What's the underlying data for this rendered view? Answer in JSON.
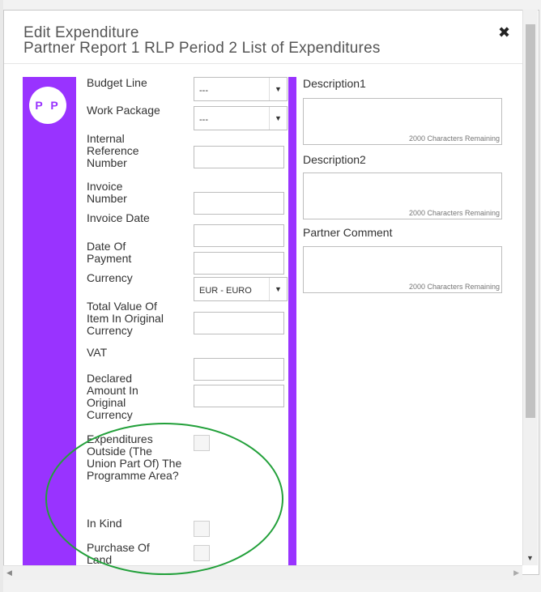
{
  "header": {
    "title_line1": "Edit Expenditure",
    "title_line2": "Partner Report 1 RLP Period 2 List of Expenditures",
    "close_glyph": "✖"
  },
  "avatar": {
    "initials": "P P"
  },
  "fields": {
    "budget_line": {
      "label": "Budget Line",
      "value": "---"
    },
    "work_package": {
      "label": "Work Package",
      "value": "---"
    },
    "internal_reference": {
      "label": "Internal Reference Number"
    },
    "invoice_number": {
      "label": "Invoice Number"
    },
    "invoice_date": {
      "label": "Invoice Date"
    },
    "date_of_payment": {
      "label": "Date Of Payment"
    },
    "currency": {
      "label": "Currency",
      "value": "EUR - EURO"
    },
    "total_value": {
      "label": "Total Value Of Item In Original Currency"
    },
    "vat": {
      "label": "VAT"
    },
    "declared_amount": {
      "label": "Declared Amount In Original Currency"
    },
    "expenditures_outside": {
      "label": "Expenditures Outside (The Union Part Of) The Programme Area?"
    },
    "in_kind": {
      "label": "In Kind"
    },
    "purchase_of_land": {
      "label": "Purchase Of Land"
    }
  },
  "right": {
    "description1": {
      "label": "Description1",
      "counter": "2000 Characters Remaining"
    },
    "description2": {
      "label": "Description2",
      "counter": "2000 Characters Remaining"
    },
    "partner_comment": {
      "label": "Partner Comment",
      "counter": "2000 Characters Remaining"
    }
  },
  "colors": {
    "accent": "#9933ff",
    "annotation": "#22a03a"
  },
  "icons": {
    "close": "close-icon",
    "dropdown": "chevron-down-icon"
  }
}
